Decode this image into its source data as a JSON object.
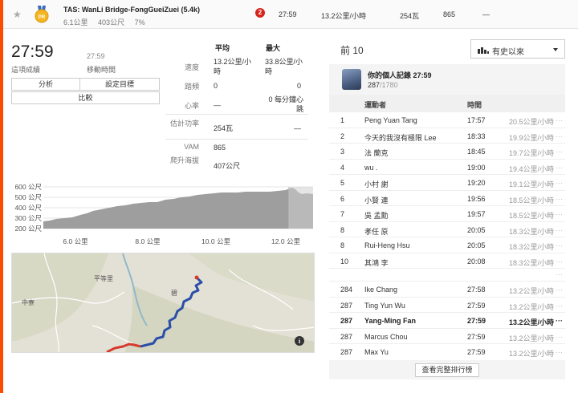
{
  "segment": {
    "star": "★",
    "medal_text": "PR",
    "name": "TAS: WanLi Bridge-FongGueiZuei (5.4k)",
    "distance": "6.1公里",
    "elevation": "403公尺",
    "grade": "7%",
    "badge": "2",
    "time": "27:59",
    "speed": "13.2公里/小時",
    "power": "254瓦",
    "value": "865",
    "extra": "—"
  },
  "summary": {
    "elapsed_time": "27:59",
    "elapsed_label": "這項成績",
    "moving_time": "27:59",
    "moving_label": "移動時間"
  },
  "buttons": {
    "analyze": "分析",
    "set_goal": "設定目標",
    "compare": "比較"
  },
  "stats": {
    "header_avg": "平均",
    "header_max": "最大",
    "rows": [
      {
        "label": "速度",
        "avg": "13.2公里/小時",
        "max": "33.8公里/小時"
      },
      {
        "label": "踏頻",
        "avg": "0",
        "max": "0"
      },
      {
        "label": "心率",
        "avg": "—",
        "max": "0 每分鐘心跳"
      },
      {
        "label": "估計功率",
        "avg": "254瓦",
        "max": "—"
      },
      {
        "label": "VAM",
        "avg": "865",
        "max": ""
      },
      {
        "label": "爬升海拔",
        "avg": "407公尺",
        "max": ""
      }
    ]
  },
  "elevation_chart": {
    "y_ticks": [
      "600 公尺",
      "500 公尺",
      "400 公尺",
      "300 公尺",
      "200 公尺"
    ],
    "x_ticks": [
      "6.0 公里",
      "8.0 公里",
      "10.0 公里",
      "12.0 公里"
    ]
  },
  "map": {
    "labels": [
      "中寮",
      "平等里",
      "碧"
    ],
    "info_icon": "i"
  },
  "leaderboard": {
    "title": "前 10",
    "filter": "有史以來",
    "pr": {
      "title": "你的個人記錄 27:59",
      "rank": "287",
      "total": "/1780"
    },
    "columns": {
      "athlete": "運動者",
      "time": "時間"
    },
    "top": [
      {
        "rank": "1",
        "name": "Peng Yuan Tang",
        "time": "17:57",
        "speed": "20.5公里/小時"
      },
      {
        "rank": "2",
        "name": "今天的我沒有極限 Lee",
        "time": "18:33",
        "speed": "19.9公里/小時"
      },
      {
        "rank": "3",
        "name": "法 蘭克",
        "time": "18:45",
        "speed": "19.7公里/小時"
      },
      {
        "rank": "4",
        "name": "wu .",
        "time": "19:00",
        "speed": "19.4公里/小時"
      },
      {
        "rank": "5",
        "name": "小村 謝",
        "time": "19:20",
        "speed": "19.1公里/小時"
      },
      {
        "rank": "6",
        "name": "小賢 連",
        "time": "19:56",
        "speed": "18.5公里/小時"
      },
      {
        "rank": "7",
        "name": "吳 孟勳",
        "time": "19:57",
        "speed": "18.5公里/小時"
      },
      {
        "rank": "8",
        "name": "孝任 原",
        "time": "20:05",
        "speed": "18.3公里/小時"
      },
      {
        "rank": "8",
        "name": "Rui-Heng Hsu",
        "time": "20:05",
        "speed": "18.3公里/小時"
      },
      {
        "rank": "10",
        "name": "其鴻 李",
        "time": "20:08",
        "speed": "18.3公里/小時"
      }
    ],
    "gap_more": "···",
    "near": [
      {
        "rank": "284",
        "name": "Ike Chang",
        "time": "27:58",
        "speed": "13.2公里/小時",
        "me": false
      },
      {
        "rank": "287",
        "name": "Ting Yun Wu",
        "time": "27:59",
        "speed": "13.2公里/小時",
        "me": false
      },
      {
        "rank": "287",
        "name": "Yang-Ming Fan",
        "time": "27:59",
        "speed": "13.2公里/小時",
        "me": true
      },
      {
        "rank": "287",
        "name": "Marcus Chou",
        "time": "27:59",
        "speed": "13.2公里/小時",
        "me": false
      },
      {
        "rank": "287",
        "name": "Max Yu",
        "time": "27:59",
        "speed": "13.2公里/小時",
        "me": false
      }
    ],
    "row_more": "···",
    "full_button": "查看完整排行榜"
  }
}
